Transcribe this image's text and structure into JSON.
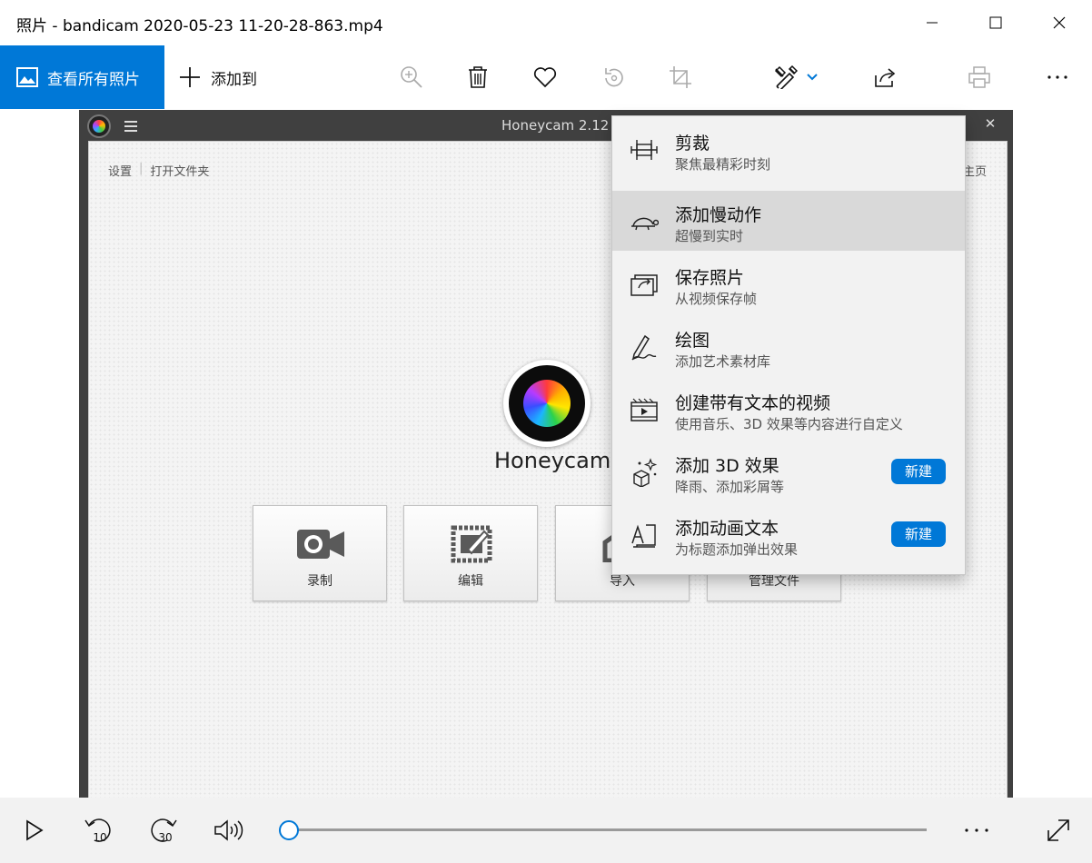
{
  "window": {
    "title": "照片 - bandicam 2020-05-23 11-20-28-863.mp4",
    "controls": [
      "minimize-icon",
      "maximize-icon",
      "close-icon"
    ]
  },
  "toolbar": {
    "view_all_label": "查看所有照片",
    "add_to_label": "添加到",
    "accent_color": "#0078d7",
    "icons": [
      "zoom-in-icon",
      "delete-icon",
      "favorite-icon",
      "rotate-icon",
      "crop-icon",
      "edit-create-icon",
      "share-icon",
      "print-icon",
      "more-icon"
    ]
  },
  "honeycam": {
    "window_title": "Honeycam 2.12",
    "close_glyph": "✕",
    "links": {
      "settings": "设置",
      "separator": "|",
      "open_folder": "打开文件夹"
    },
    "home_partial": "主页",
    "app_name": "Honeycam",
    "buttons": [
      {
        "label": "录制",
        "icon": "camera-icon"
      },
      {
        "label": "编辑",
        "icon": "edit-frame-icon"
      },
      {
        "label": "导入",
        "icon": "import-icon"
      },
      {
        "label": "管理文件",
        "icon": "manage-files-icon"
      }
    ]
  },
  "edit_menu": {
    "items": [
      {
        "title": "剪裁",
        "subtitle": "聚焦最精彩时刻",
        "icon": "trim-icon",
        "badge": ""
      },
      {
        "title": "添加慢动作",
        "subtitle": "超慢到实时",
        "icon": "turtle-slow-motion-icon",
        "badge": "",
        "highlighted": true
      },
      {
        "title": "保存照片",
        "subtitle": "从视频保存帧",
        "icon": "save-frame-icon",
        "badge": ""
      },
      {
        "title": "绘图",
        "subtitle": "添加艺术素材库",
        "icon": "pen-draw-icon",
        "badge": ""
      },
      {
        "title": "创建带有文本的视频",
        "subtitle": "使用音乐、3D 效果等内容进行自定义",
        "icon": "video-with-text-icon",
        "badge": ""
      },
      {
        "title": "添加 3D 效果",
        "subtitle": "降雨、添加彩屑等",
        "icon": "3d-effects-icon",
        "badge": "新建"
      },
      {
        "title": "添加动画文本",
        "subtitle": "为标题添加弹出效果",
        "icon": "animated-text-icon",
        "badge": "新建"
      }
    ]
  },
  "playback": {
    "skip_back_seconds": "10",
    "skip_forward_seconds": "30",
    "progress": 0,
    "icons": [
      "play-icon",
      "skip-back-10-icon",
      "skip-forward-30-icon",
      "volume-icon",
      "more-icon",
      "fullscreen-icon"
    ]
  }
}
